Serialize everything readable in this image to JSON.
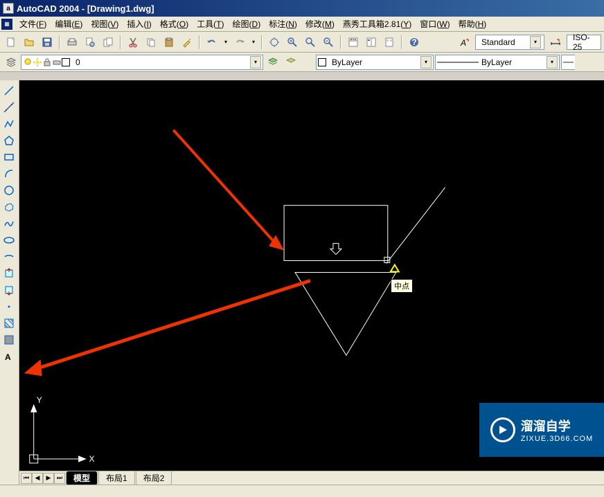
{
  "title": "AutoCAD 2004 - [Drawing1.dwg]",
  "title_icon": "a",
  "menu": {
    "items": [
      {
        "label": "文件",
        "key": "F"
      },
      {
        "label": "编辑",
        "key": "E"
      },
      {
        "label": "视图",
        "key": "V"
      },
      {
        "label": "插入",
        "key": "I"
      },
      {
        "label": "格式",
        "key": "O"
      },
      {
        "label": "工具",
        "key": "T"
      },
      {
        "label": "绘图",
        "key": "D"
      },
      {
        "label": "标注",
        "key": "N"
      },
      {
        "label": "修改",
        "key": "M"
      },
      {
        "label": "燕秀工具箱2.81",
        "key": "Y"
      },
      {
        "label": "窗口",
        "key": "W"
      },
      {
        "label": "帮助",
        "key": "H"
      }
    ]
  },
  "layer": {
    "value": "0"
  },
  "color": {
    "value": "ByLayer"
  },
  "linetype": {
    "value": "ByLayer"
  },
  "textstyle": {
    "value": "Standard"
  },
  "dimstyle": {
    "value": "ISO-25"
  },
  "tabs": {
    "items": [
      {
        "label": "模型",
        "active": true
      },
      {
        "label": "布局1",
        "active": false
      },
      {
        "label": "布局2",
        "active": false
      }
    ]
  },
  "snap_tooltip": "中点",
  "ucs": {
    "x": "X",
    "y": "Y"
  },
  "watermark": {
    "title": "溜溜自学",
    "sub": "ZIXUE.3D66.COM"
  }
}
